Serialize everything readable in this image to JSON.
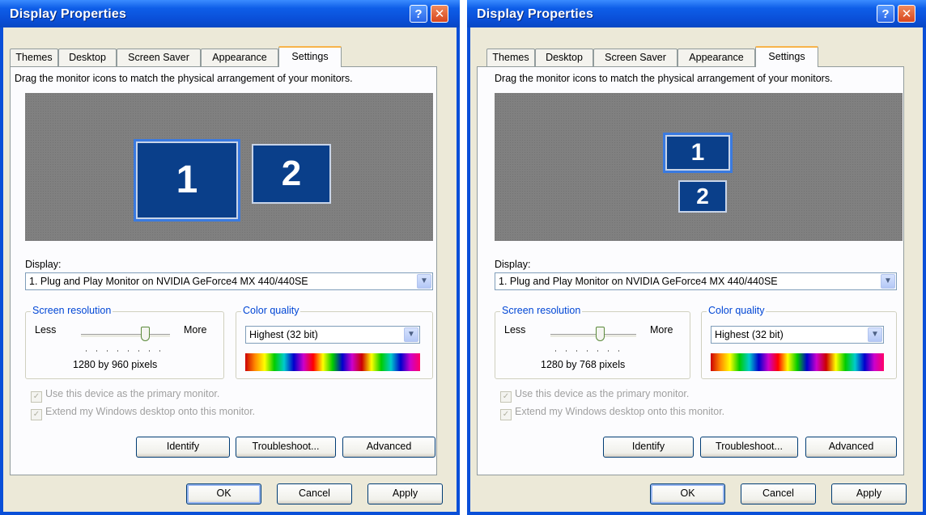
{
  "dialogs": [
    {
      "title": "Display Properties",
      "help_glyph": "?",
      "close_glyph": "✕",
      "tabs": [
        "Themes",
        "Desktop",
        "Screen Saver",
        "Appearance",
        "Settings"
      ],
      "active_tab": "Settings",
      "instruction": "Drag the monitor icons to match the physical arrangement of your monitors.",
      "monitors": [
        "1",
        "2"
      ],
      "display_label": "Display:",
      "display_value": "1. Plug and Play Monitor on NVIDIA GeForce4 MX 440/440SE",
      "resolution": {
        "title": "Screen resolution",
        "less": "Less",
        "more": "More",
        "value": "1280 by 960 pixels"
      },
      "color_quality": {
        "title": "Color quality",
        "value": "Highest (32 bit)"
      },
      "checkboxes": [
        "Use this device as the primary monitor.",
        "Extend my Windows desktop onto this monitor."
      ],
      "buttons": [
        "Identify",
        "Troubleshoot...",
        "Advanced"
      ],
      "footer_buttons": [
        "OK",
        "Cancel",
        "Apply"
      ]
    },
    {
      "title": "Display Properties",
      "help_glyph": "?",
      "close_glyph": "✕",
      "tabs": [
        "Themes",
        "Desktop",
        "Screen Saver",
        "Appearance",
        "Settings"
      ],
      "active_tab": "Settings",
      "instruction": "Drag the monitor icons to match the physical arrangement of your monitors.",
      "monitors": [
        "1",
        "2"
      ],
      "display_label": "Display:",
      "display_value": "1. Plug and Play Monitor on NVIDIA GeForce4 MX 440/440SE",
      "resolution": {
        "title": "Screen resolution",
        "less": "Less",
        "more": "More",
        "value": "1280 by 768 pixels"
      },
      "color_quality": {
        "title": "Color quality",
        "value": "Highest (32 bit)"
      },
      "checkboxes": [
        "Use this device as the primary monitor.",
        "Extend my Windows desktop onto this monitor."
      ],
      "buttons": [
        "Identify",
        "Troubleshoot...",
        "Advanced"
      ],
      "footer_buttons": [
        "OK",
        "Cancel",
        "Apply"
      ]
    }
  ],
  "colors": {
    "titlebar": "#0a4fd8",
    "dialog_bg": "#ece9d8",
    "monitor_fill": "#0a3f8a",
    "preview_bg": "#808080",
    "group_title": "#0046d5"
  }
}
